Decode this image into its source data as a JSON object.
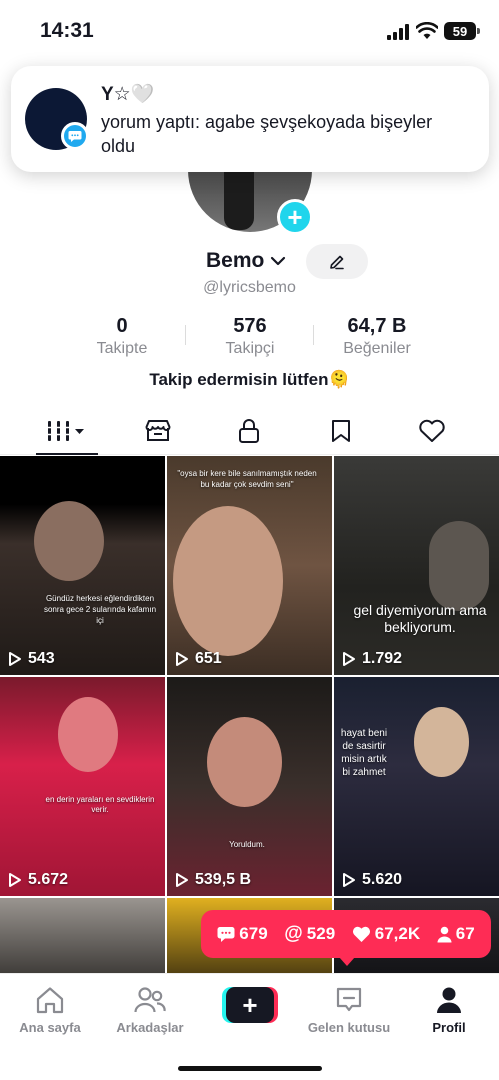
{
  "status_bar": {
    "time": "14:31",
    "battery": "59"
  },
  "notification": {
    "title": "Y☆🤍",
    "body": "yorum yaptı: agabe şevşekoyada bişeyler oldu"
  },
  "profile": {
    "name": "Bemo",
    "handle": "@lyricsbemo",
    "stats": [
      {
        "value": "0",
        "label": "Takipte"
      },
      {
        "value": "576",
        "label": "Takipçi"
      },
      {
        "value": "64,7 B",
        "label": "Beğeniler"
      }
    ],
    "bio": "Takip edermisin lütfen🫠"
  },
  "tabs": [
    "videos-grid",
    "shop",
    "private",
    "saved",
    "liked"
  ],
  "videos": [
    {
      "views": "543",
      "caption": "Gündüz herkesi eğlendirdikten sonra gece 2 sularında kafamın içi"
    },
    {
      "views": "651",
      "caption": "\"oysa bir kere bile sanılmamıştık neden bu kadar çok sevdim seni\""
    },
    {
      "views": "1.792",
      "caption": "gel diyemiyorum ama bekliyorum."
    },
    {
      "views": "5.672",
      "caption": "en derin yaraları en sevdiklerin verir."
    },
    {
      "views": "539,5 B",
      "caption": "Yoruldum."
    },
    {
      "views": "5.620",
      "caption": "hayat beni de sasirtir misin artık bi zahmet"
    }
  ],
  "activity_popup": {
    "comments": "679",
    "mentions": "529",
    "likes": "67,2K",
    "followers": "67"
  },
  "nav": {
    "home": "Ana sayfa",
    "friends": "Arkadaşlar",
    "inbox": "Gelen kutusu",
    "profile": "Profil"
  },
  "colors": {
    "accent": "#fe2c55",
    "cyan": "#25f4ee",
    "blue": "#20d5ec"
  }
}
